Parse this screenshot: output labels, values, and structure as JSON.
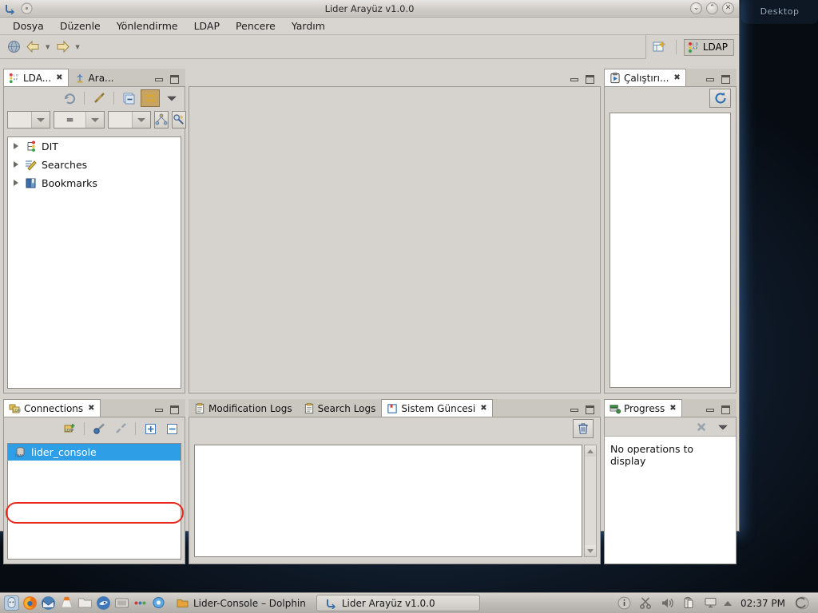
{
  "desktop": {
    "widget_label": "Desktop"
  },
  "window": {
    "title": "Lider Arayüz v1.0.0",
    "buttons": {
      "minimize": "⌄",
      "maximize": "⌃",
      "close": "✕"
    }
  },
  "menubar": {
    "items": [
      {
        "label": "Dosya"
      },
      {
        "label": "Düzenle"
      },
      {
        "label": "Yönlendirme"
      },
      {
        "label": "LDAP"
      },
      {
        "label": "Pencere"
      },
      {
        "label": "Yardım"
      }
    ]
  },
  "toolbar": {
    "back_tooltip": "Geri",
    "forward_tooltip": "İleri",
    "perspective": {
      "open_label": "Yeni bakış açısı aç",
      "current": "LDAP"
    }
  },
  "left_panel": {
    "tabs": [
      {
        "label": "LDA...",
        "active": true,
        "closable": true
      },
      {
        "label": "Ara...",
        "active": false,
        "closable": false
      }
    ],
    "tree": [
      {
        "label": "DIT"
      },
      {
        "label": "Searches"
      },
      {
        "label": "Bookmarks"
      }
    ],
    "filter": {
      "operator": "="
    }
  },
  "editor_area": {
    "content": ""
  },
  "run_panel": {
    "tabs": [
      {
        "label": "Çalıştırı...",
        "active": true,
        "closable": true
      }
    ],
    "refresh_label": "Yenile",
    "content": ""
  },
  "connections_panel": {
    "tabs": [
      {
        "label": "Connections",
        "active": true,
        "closable": true
      }
    ],
    "items": [
      {
        "label": "lider_console",
        "selected": true
      }
    ]
  },
  "logs_panel": {
    "tabs": [
      {
        "label": "Modification Logs",
        "active": false,
        "closable": false
      },
      {
        "label": "Search Logs",
        "active": false,
        "closable": false
      },
      {
        "label": "Sistem Güncesi",
        "active": true,
        "closable": true
      }
    ],
    "clear_label": "Temizle",
    "content": ""
  },
  "progress_panel": {
    "tabs": [
      {
        "label": "Progress",
        "active": true,
        "closable": true
      }
    ],
    "empty_message": "No operations to display"
  },
  "taskbar": {
    "windows": [
      {
        "label": "Lider-Console – Dolphin",
        "framed": false
      },
      {
        "label": "Lider Arayüz v1.0.0",
        "framed": true
      }
    ],
    "clock": "02:37 PM"
  },
  "colors": {
    "selection_blue": "#2e9fe6",
    "annotation_red": "#e8271c",
    "chrome_gray": "#d6d2cd",
    "active_tab_white": "#ffffff"
  }
}
